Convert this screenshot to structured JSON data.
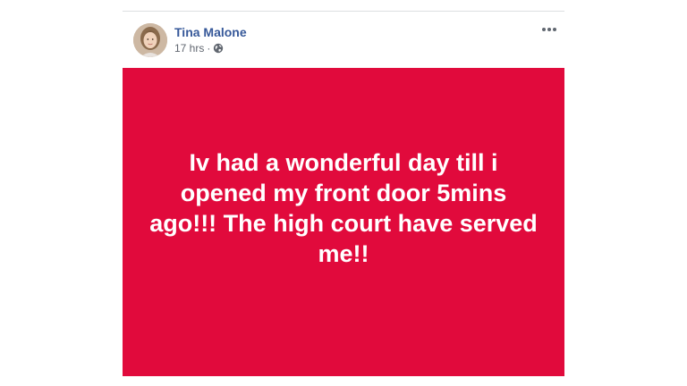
{
  "post": {
    "author": {
      "name": "Tina Malone",
      "avatar_icon": "profile-photo"
    },
    "meta": {
      "timestamp": "17 hrs",
      "separator": "·",
      "privacy_icon": "globe-icon"
    },
    "more_icon": "more-options-icon",
    "status": {
      "text": "Iv had a wonderful day till i opened my front door 5mins ago!!! The high court have served me!!",
      "background_color": "#e10a3c",
      "text_color": "#ffffff"
    }
  },
  "colors": {
    "author_link": "#365899",
    "meta_text": "#616770"
  }
}
